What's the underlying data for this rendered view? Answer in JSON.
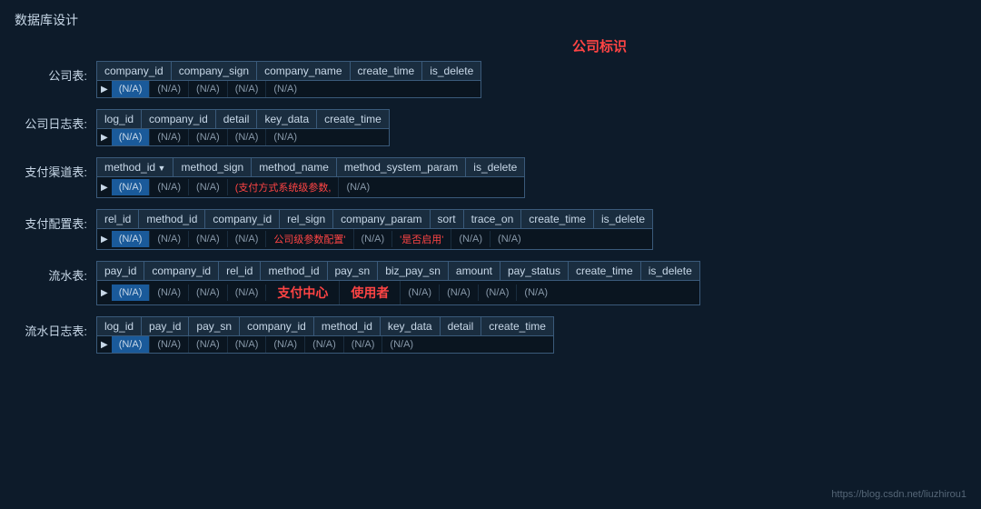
{
  "pageTitle": "数据库设计",
  "companySignLabel": "公司标识",
  "watermark": "https://blog.csdn.net/liuzhirou1",
  "sections": [
    {
      "label": "公司表:",
      "columns": [
        "company_id",
        "company_sign",
        "company_name",
        "create_time",
        "is_delete"
      ],
      "rows": [
        [
          "(N/A)",
          "(N/A)",
          "(N/A)",
          "(N/A)",
          "(N/A)"
        ]
      ],
      "highlightCol": 0,
      "specialCols": []
    },
    {
      "label": "公司日志表:",
      "columns": [
        "log_id",
        "company_id",
        "detail",
        "key_data",
        "create_time"
      ],
      "rows": [
        [
          "(N/A)",
          "(N/A)",
          "(N/A)",
          "(N/A)",
          "(N/A)"
        ]
      ],
      "highlightCol": 0,
      "specialCols": []
    },
    {
      "label": "支付渠道表:",
      "columns": [
        "method_id",
        "method_sign",
        "method_name",
        "method_system_param",
        "is_delete"
      ],
      "colArrow": [
        0
      ],
      "rows": [
        [
          "(N/A)",
          "(N/A)",
          "(N/A)",
          "(支付方式系统级参数,",
          "(N/A)"
        ]
      ],
      "highlightCol": 0,
      "specialCols": [
        3
      ]
    },
    {
      "label": "支付配置表:",
      "columns": [
        "rel_id",
        "method_id",
        "company_id",
        "rel_sign",
        "company_param",
        "sort",
        "trace_on",
        "create_time",
        "is_delete"
      ],
      "rows": [
        [
          "(N/A)",
          "(N/A)",
          "(N/A)",
          "(N/A)",
          "公司级参数配置'",
          "(N/A)",
          "'是否启用'",
          "(N/A)",
          "(N/A)"
        ]
      ],
      "highlightCol": 0,
      "specialCols": [
        4,
        6
      ]
    },
    {
      "label": "流水表:",
      "columns": [
        "pay_id",
        "company_id",
        "rel_id",
        "method_id",
        "pay_sn",
        "biz_pay_sn",
        "amount",
        "pay_status",
        "create_time",
        "is_delete"
      ],
      "rows": [
        [
          "(N/A)",
          "(N/A)",
          "(N/A)",
          "(N/A)",
          "",
          "",
          "(N/A)",
          "(N/A)",
          "(N/A)",
          "(N/A)"
        ]
      ],
      "highlightCol": 0,
      "specialCols": [],
      "hasPayCenter": true
    },
    {
      "label": "流水日志表:",
      "columns": [
        "log_id",
        "pay_id",
        "pay_sn",
        "company_id",
        "method_id",
        "key_data",
        "detail",
        "create_time"
      ],
      "rows": [
        [
          "(N/A)",
          "(N/A)",
          "(N/A)",
          "(N/A)",
          "(N/A)",
          "(N/A)",
          "(N/A)",
          "(N/A)"
        ]
      ],
      "highlightCol": 0,
      "specialCols": []
    }
  ]
}
